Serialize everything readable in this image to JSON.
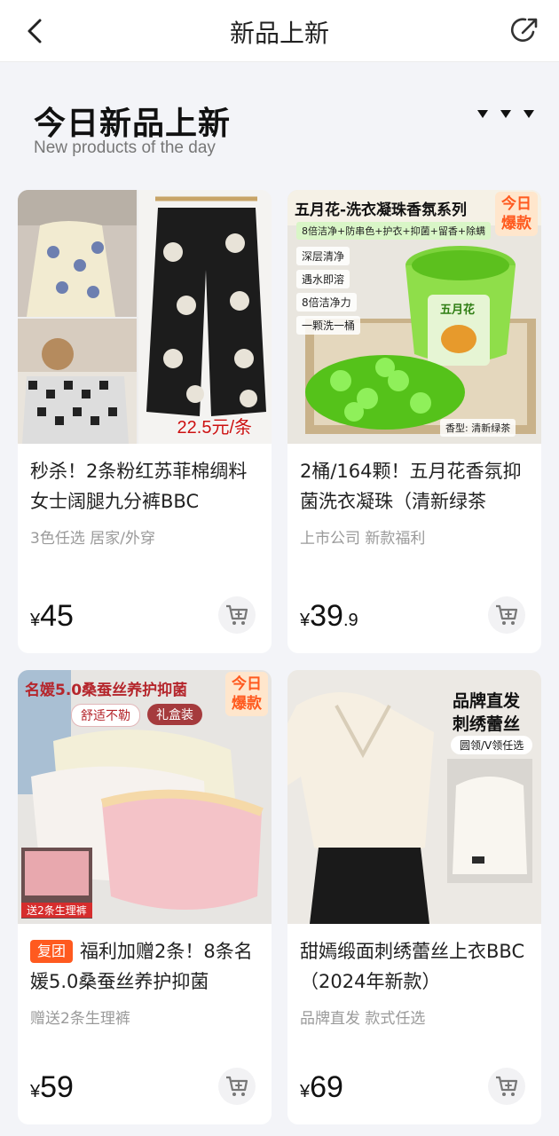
{
  "nav": {
    "title": "新品上新"
  },
  "header": {
    "title": "今日新品上新",
    "subtitle": "New products of the day"
  },
  "products": [
    {
      "title": "秒杀！2条粉红苏菲棉绸料女士阔腿九分裤BBC",
      "tag": "",
      "subtitle": "3色任选  居家/外穿",
      "price_symbol": "¥",
      "price_int": "45",
      "price_dec": "",
      "image": {
        "overlay_price": "22.5元/条"
      }
    },
    {
      "title": "2桶/164颗！五月花香氛抑菌洗衣凝珠（清新绿茶",
      "tag": "",
      "subtitle": "上市公司  新款福利",
      "price_symbol": "¥",
      "price_int": "39",
      "price_dec": ".9",
      "image": {
        "banner": "五月花-洗衣凝珠香氛系列",
        "badge": "今日爆款",
        "features_line": "8倍洁净+防串色+护衣+抑菌+留香+除螨",
        "bullets": [
          "深层清净",
          "遇水即溶",
          "8倍洁净力",
          "一颗洗一桶"
        ],
        "tub_label": "五月花",
        "scent_label": "香型: 清新绿茶"
      }
    },
    {
      "title": "福利加赠2条！8条名媛5.0桑蚕丝养护抑菌",
      "tag": "复团",
      "subtitle": "赠送2条生理裤",
      "price_symbol": "¥",
      "price_int": "59",
      "price_dec": "",
      "image": {
        "banner": "名媛5.0桑蚕丝养护抑菌",
        "badge": "今日爆款",
        "chip1": "舒适不勒",
        "chip2": "礼盒装",
        "promo": "送2条生理裤"
      }
    },
    {
      "title": "甜嫣缎面刺绣蕾丝上衣BBC（2024年新款）",
      "tag": "",
      "subtitle": "品牌直发  款式任选",
      "price_symbol": "¥",
      "price_int": "69",
      "price_dec": "",
      "image": {
        "line1": "品牌直发",
        "line2": "刺绣蕾丝",
        "chip": "圆领/V领任选"
      }
    }
  ],
  "colors": {
    "accent": "#ff5a1f",
    "price": "#111111",
    "badge_bg": "#ffe6cc"
  }
}
